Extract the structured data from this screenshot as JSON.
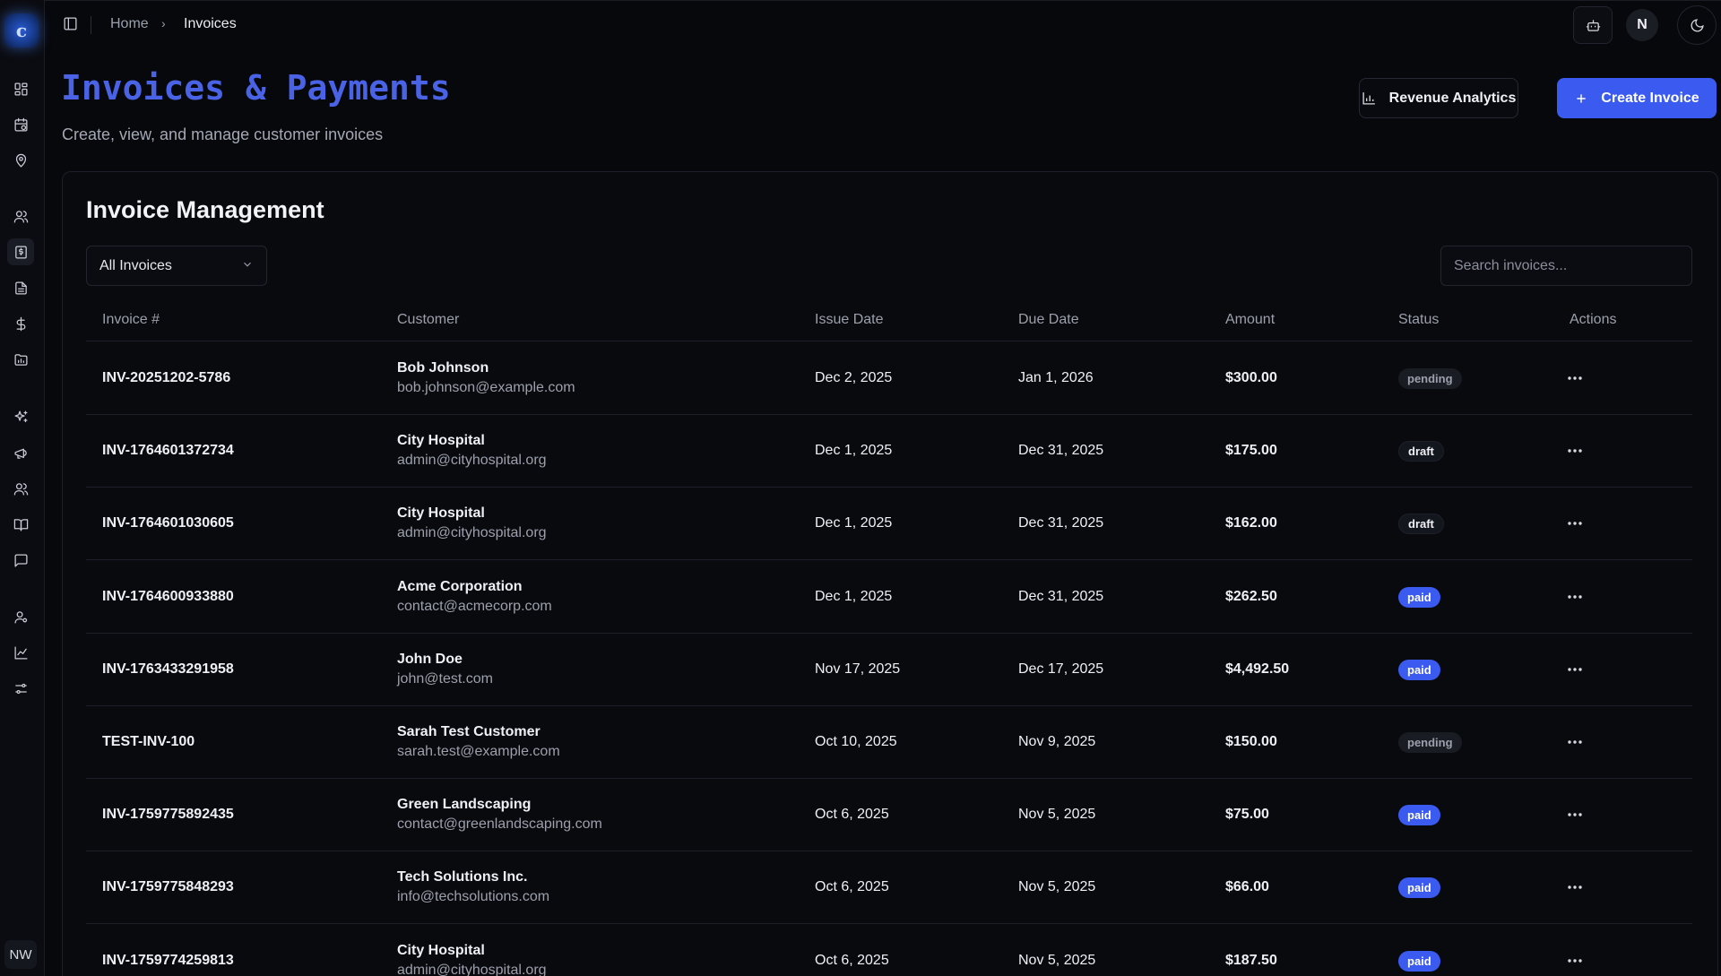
{
  "sidebar": {
    "logo_text": "c",
    "user_initials": "NW",
    "items": [
      {
        "icon": "dashboard-icon"
      },
      {
        "icon": "calendar-clock-icon"
      },
      {
        "icon": "map-pin-icon"
      },
      {
        "icon": "users-icon"
      },
      {
        "icon": "invoice-icon",
        "active": true
      },
      {
        "icon": "document-icon"
      },
      {
        "icon": "dollar-icon"
      },
      {
        "icon": "folder-chart-icon"
      },
      {
        "icon": "sparkles-icon"
      },
      {
        "icon": "megaphone-icon"
      },
      {
        "icon": "team-icon"
      },
      {
        "icon": "book-icon"
      },
      {
        "icon": "message-icon"
      },
      {
        "icon": "user-settings-icon"
      },
      {
        "icon": "line-chart-icon"
      },
      {
        "icon": "sliders-icon"
      }
    ]
  },
  "breadcrumb": {
    "home": "Home",
    "current": "Invoices"
  },
  "topbar": {
    "avatar_initial": "N"
  },
  "header": {
    "title": "Invoices & Payments",
    "subtitle": "Create, view, and manage customer invoices",
    "analytics_label": "Revenue Analytics",
    "create_label": "Create Invoice"
  },
  "card": {
    "title": "Invoice Management",
    "filter_value": "All Invoices",
    "search_placeholder": "Search invoices..."
  },
  "table": {
    "columns": [
      "Invoice #",
      "Customer",
      "Issue Date",
      "Due Date",
      "Amount",
      "Status",
      "Actions"
    ],
    "rows": [
      {
        "invoice": "INV-20251202-5786",
        "name": "Bob Johnson",
        "email": "bob.johnson@example.com",
        "issue": "Dec 2, 2025",
        "due": "Jan 1, 2026",
        "amount": "$300.00",
        "status": "pending"
      },
      {
        "invoice": "INV-1764601372734",
        "name": "City Hospital",
        "email": "admin@cityhospital.org",
        "issue": "Dec 1, 2025",
        "due": "Dec 31, 2025",
        "amount": "$175.00",
        "status": "draft"
      },
      {
        "invoice": "INV-1764601030605",
        "name": "City Hospital",
        "email": "admin@cityhospital.org",
        "issue": "Dec 1, 2025",
        "due": "Dec 31, 2025",
        "amount": "$162.00",
        "status": "draft"
      },
      {
        "invoice": "INV-1764600933880",
        "name": "Acme Corporation",
        "email": "contact@acmecorp.com",
        "issue": "Dec 1, 2025",
        "due": "Dec 31, 2025",
        "amount": "$262.50",
        "status": "paid"
      },
      {
        "invoice": "INV-1763433291958",
        "name": "John Doe",
        "email": "john@test.com",
        "issue": "Nov 17, 2025",
        "due": "Dec 17, 2025",
        "amount": "$4,492.50",
        "status": "paid"
      },
      {
        "invoice": "TEST-INV-100",
        "name": "Sarah Test Customer",
        "email": "sarah.test@example.com",
        "issue": "Oct 10, 2025",
        "due": "Nov 9, 2025",
        "amount": "$150.00",
        "status": "pending"
      },
      {
        "invoice": "INV-1759775892435",
        "name": "Green Landscaping",
        "email": "contact@greenlandscaping.com",
        "issue": "Oct 6, 2025",
        "due": "Nov 5, 2025",
        "amount": "$75.00",
        "status": "paid"
      },
      {
        "invoice": "INV-1759775848293",
        "name": "Tech Solutions Inc.",
        "email": "info@techsolutions.com",
        "issue": "Oct 6, 2025",
        "due": "Nov 5, 2025",
        "amount": "$66.00",
        "status": "paid"
      },
      {
        "invoice": "INV-1759774259813",
        "name": "City Hospital",
        "email": "admin@cityhospital.org",
        "issue": "Oct 6, 2025",
        "due": "Nov 5, 2025",
        "amount": "$187.50",
        "status": "paid"
      }
    ]
  },
  "colors": {
    "accent": "#3b5af0",
    "title": "#4a63e6",
    "background": "#07080c"
  }
}
